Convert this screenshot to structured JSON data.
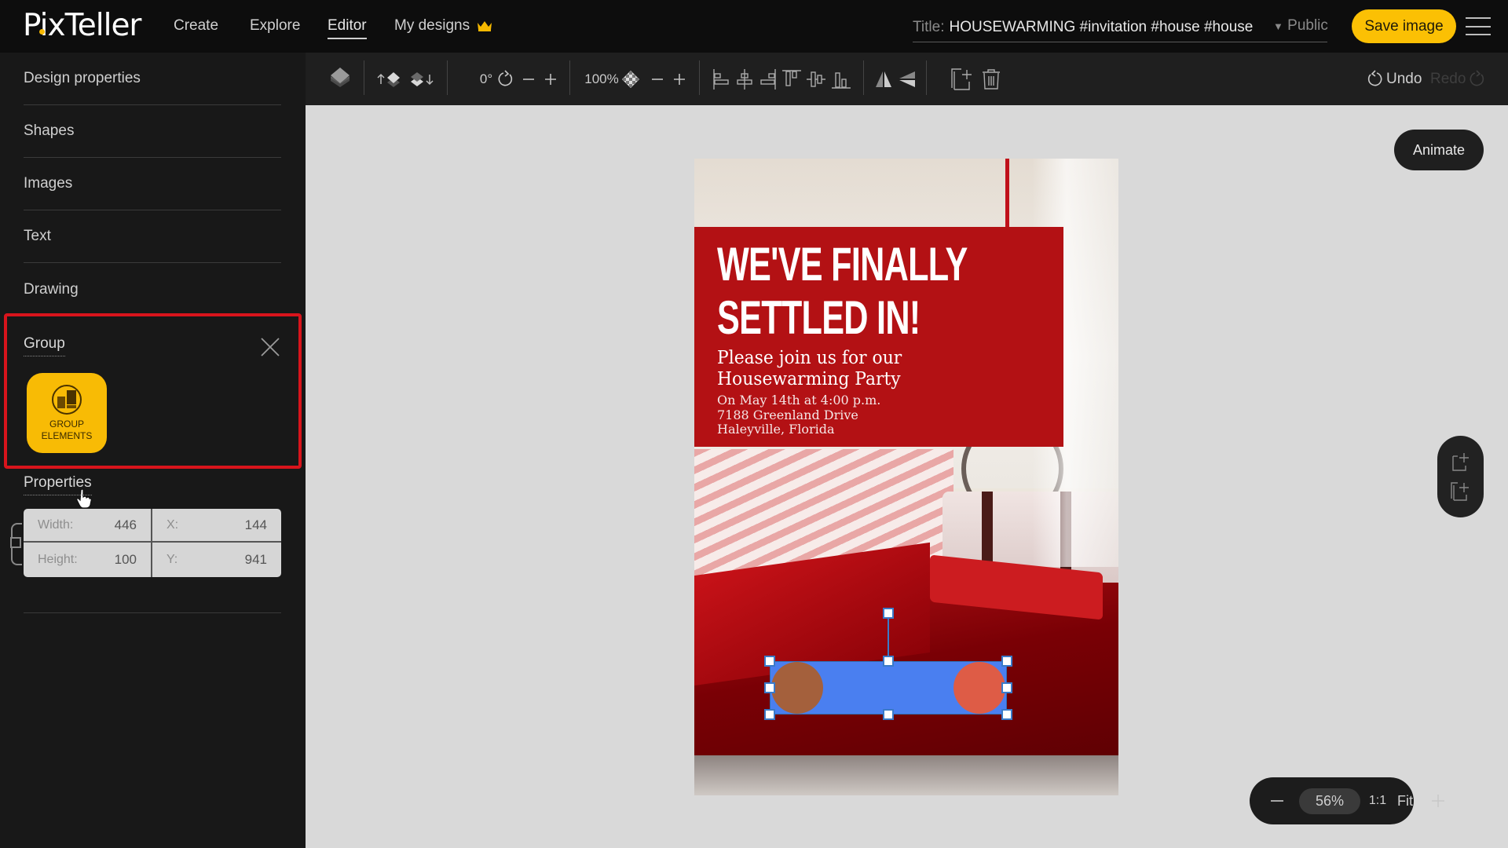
{
  "app": {
    "logo": "PixTeller",
    "brand_color": "#fbc004"
  },
  "header": {
    "nav": [
      {
        "label": "Create"
      },
      {
        "label": "Explore"
      },
      {
        "label": "Editor",
        "active": true
      },
      {
        "label": "My designs",
        "icon": "crown-icon"
      }
    ],
    "title_label": "Title:",
    "title_value": "HOUSEWARMING #invitation #house #house",
    "visibility": "Public",
    "visibility_icon": "triangle-down-icon",
    "save_label": "Save image",
    "menu_icon": "hamburger-icon"
  },
  "sidebar": {
    "items": [
      {
        "label": "Design properties"
      },
      {
        "label": "Shapes"
      },
      {
        "label": "Images"
      },
      {
        "label": "Text"
      },
      {
        "label": "Drawing"
      }
    ],
    "group": {
      "title": "Group",
      "close_icon": "close-icon",
      "button_line1": "GROUP",
      "button_line2": "ELEMENTS",
      "button_icon": "group-elements-icon",
      "highlight_color": "#d8141c"
    },
    "properties": {
      "title": "Properties",
      "width_label": "Width:",
      "width_value": "446",
      "height_label": "Height:",
      "height_value": "100",
      "x_label": "X:",
      "x_value": "144",
      "y_label": "Y:",
      "y_value": "941"
    }
  },
  "toolbar": {
    "rotation_value": "0°",
    "opacity_value": "100%",
    "undo_label": "Undo",
    "redo_label": "Redo",
    "icons": [
      "layers-icon",
      "bring-forward-icon",
      "send-backward-icon",
      "rotate-icon",
      "minus-icon",
      "plus-icon",
      "transparency-icon",
      "align-left-icon",
      "align-center-icon",
      "align-right-icon",
      "align-top-icon",
      "align-middle-icon",
      "align-bottom-icon",
      "flip-horizontal-icon",
      "flip-vertical-icon",
      "duplicate-icon",
      "delete-icon"
    ]
  },
  "workspace": {
    "animate_label": "Animate",
    "zoom_value": "56%",
    "zoom_one_to_one": "1:1",
    "zoom_fit": "Fit"
  },
  "canvas": {
    "headline_line1": "WE'VE FINALLY",
    "headline_line2": "SETTLED IN!",
    "sub_line1": "Please join us for our",
    "sub_line2": "Housewarming Party",
    "detail_line1": "On May 14th at 4:00 p.m.",
    "detail_line2": "7188 Greenland Drive",
    "detail_line3": "Haleyville, Florida",
    "banner_color": "#b31114",
    "selection": {
      "rect_color": "#4a7ff0",
      "left_circle_color": "#a4603c",
      "right_circle_color": "#de5c46"
    }
  }
}
